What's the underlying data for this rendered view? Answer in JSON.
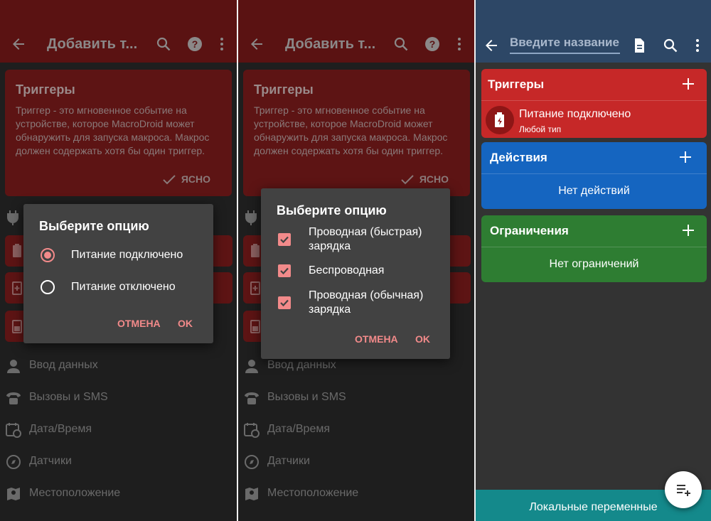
{
  "panel1": {
    "toolbar_title": "Добавить т...",
    "info": {
      "title": "Триггеры",
      "text": "Триггер - это мгновенное событие на устройстве, которое MacroDroid может обнаружить для запуска макроса. Макрос должен содержать хотя бы один триггер.",
      "ok_label": "ЯСНО"
    },
    "categories": [
      "Ввод данных",
      "Вызовы и SMS",
      "Дата/Время",
      "Датчики",
      "Местоположение"
    ],
    "dialog": {
      "title": "Выберите опцию",
      "options": [
        {
          "label": "Питание подключено",
          "selected": true
        },
        {
          "label": "Питание отключено",
          "selected": false
        }
      ],
      "cancel": "ОТМЕНА",
      "ok": "OK"
    }
  },
  "panel2": {
    "toolbar_title": "Добавить т...",
    "info": {
      "title": "Триггеры",
      "text": "Триггер - это мгновенное событие на устройстве, которое MacroDroid может обнаружить для запуска макроса. Макрос должен содержать хотя бы один триггер.",
      "ok_label": "ЯСНО"
    },
    "categories": [
      "Ввод данных",
      "Вызовы и SMS",
      "Дата/Время",
      "Датчики",
      "Местоположение"
    ],
    "dialog": {
      "title": "Выберите опцию",
      "options": [
        {
          "line1": "Проводная (быстрая)",
          "line2": "зарядка",
          "checked": true
        },
        {
          "line1": "Беспроводная",
          "line2": "",
          "checked": true
        },
        {
          "line1": "Проводная (обычная)",
          "line2": "зарядка",
          "checked": true
        }
      ],
      "cancel": "ОТМЕНА",
      "ok": "OK"
    }
  },
  "panel3": {
    "name_placeholder": "Введите название",
    "triggers": {
      "title": "Триггеры",
      "item_title": "Питание подключено",
      "item_subtitle": "Любой тип",
      "color": "#c62828"
    },
    "actions": {
      "title": "Действия",
      "empty": "Нет действий",
      "color": "#1565c0"
    },
    "constraints": {
      "title": "Ограничения",
      "empty": "Нет ограничений",
      "color": "#2e7d32"
    },
    "bottom_label": "Локальные переменные"
  },
  "icons": {
    "back": "arrow-left-icon",
    "search": "search-icon",
    "help": "help-icon",
    "more": "more-vertical-icon",
    "document": "document-icon",
    "plus": "plus-icon",
    "battery": "battery-icon",
    "fab": "playlist-add-icon"
  }
}
